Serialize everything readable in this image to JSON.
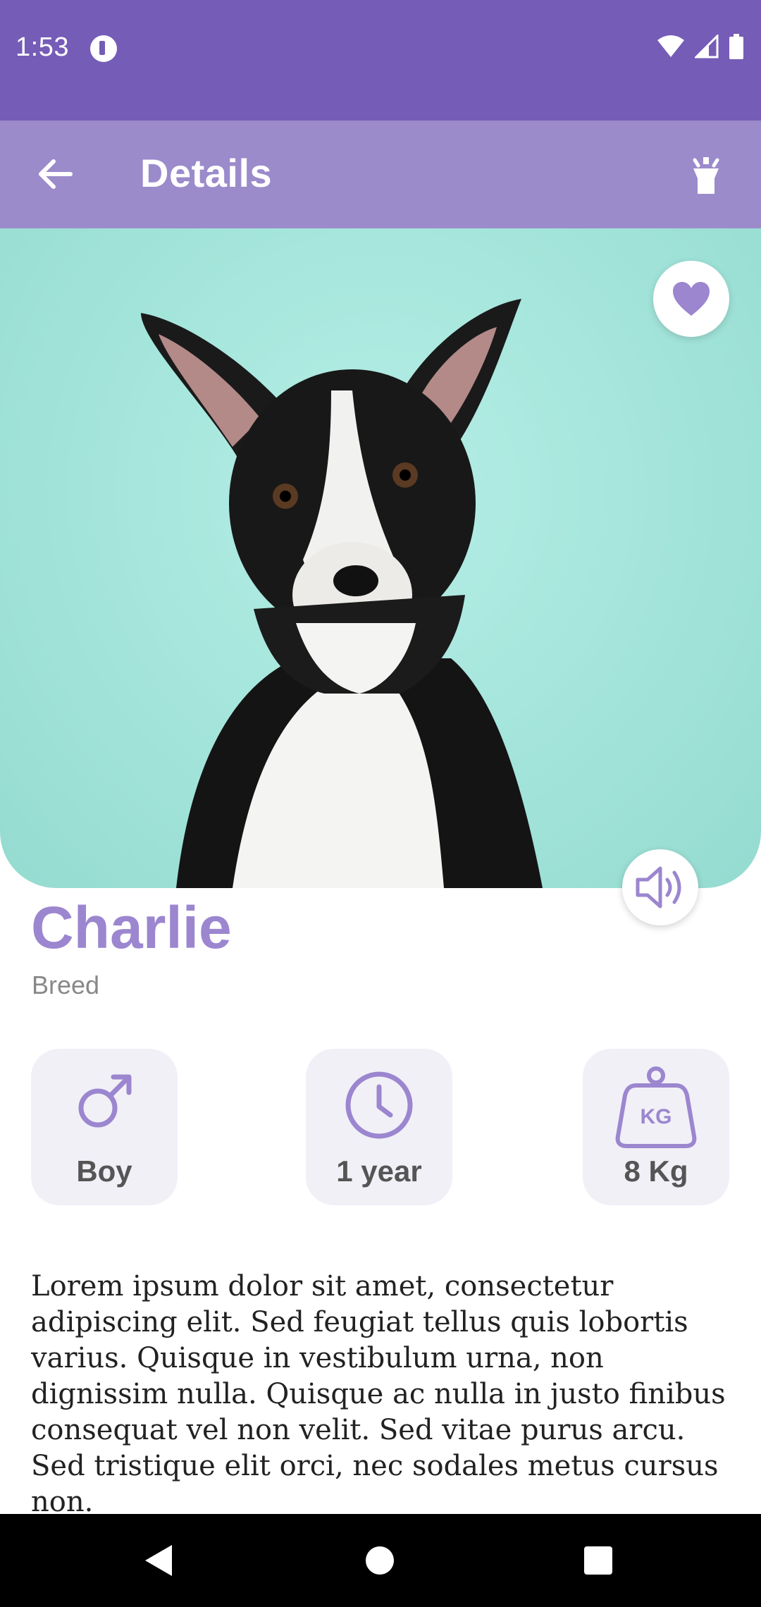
{
  "status_bar": {
    "time": "1:53",
    "icons": [
      "p-icon",
      "wifi-icon",
      "signal-icon",
      "battery-icon"
    ]
  },
  "app_bar": {
    "title": "Details",
    "back_icon": "arrow-left-icon",
    "action_icon": "flashlight-icon"
  },
  "pet": {
    "name": "Charlie",
    "breed": "Breed",
    "favorite_icon": "heart-icon",
    "sound_icon": "speaker-icon"
  },
  "info_cards": [
    {
      "label": "Boy",
      "icon": "male-icon"
    },
    {
      "label": "1 year",
      "icon": "clock-icon"
    },
    {
      "label": "8 Kg",
      "icon": "weight-icon",
      "icon_text": "KG"
    }
  ],
  "description": "Lorem ipsum dolor sit amet, consectetur adipiscing elit. Sed feugiat tellus quis lobortis varius. Quisque in vestibulum urna, non dignissim nulla. Quisque ac nulla in justo finibus consequat vel non velit. Sed vitae purus arcu. Sed tristique elit orci, nec sodales metus cursus non.",
  "colors": {
    "status_bar": "#745cb7",
    "app_bar": "#9b8bcb",
    "accent": "#9b86cf",
    "hero_background": "#a6e6dc",
    "card_background": "#f1f0f7"
  },
  "nav_bar": {
    "icons": [
      "nav-back-icon",
      "nav-home-icon",
      "nav-recents-icon"
    ]
  }
}
